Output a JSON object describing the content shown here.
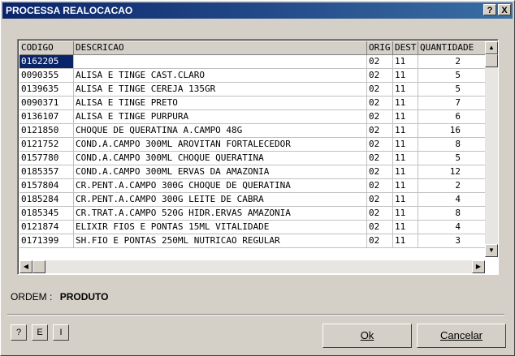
{
  "window": {
    "title": "PROCESSA REALOCACAO",
    "help_btn": "?",
    "close_btn": "X"
  },
  "table": {
    "columns": [
      "CODIGO",
      "DESCRICAO",
      "ORIG",
      "DEST",
      "QUANTIDADE"
    ],
    "rows": [
      {
        "codigo": "0162205",
        "descricao": "",
        "orig": "02",
        "dest": "11",
        "qtd": "2",
        "selected": true
      },
      {
        "codigo": "0090355",
        "descricao": "ALISA E TINGE CAST.CLARO",
        "orig": "02",
        "dest": "11",
        "qtd": "5"
      },
      {
        "codigo": "0139635",
        "descricao": "ALISA E TINGE CEREJA 135GR",
        "orig": "02",
        "dest": "11",
        "qtd": "5"
      },
      {
        "codigo": "0090371",
        "descricao": "ALISA E TINGE PRETO",
        "orig": "02",
        "dest": "11",
        "qtd": "7"
      },
      {
        "codigo": "0136107",
        "descricao": "ALISA E TINGE PURPURA",
        "orig": "02",
        "dest": "11",
        "qtd": "6"
      },
      {
        "codigo": "0121850",
        "descricao": "CHOQUE DE QUERATINA A.CAMPO 48G",
        "orig": "02",
        "dest": "11",
        "qtd": "16"
      },
      {
        "codigo": "0121752",
        "descricao": "COND.A.CAMPO 300ML AROVITAN FORTALECEDOR",
        "orig": "02",
        "dest": "11",
        "qtd": "8"
      },
      {
        "codigo": "0157780",
        "descricao": "COND.A.CAMPO 300ML CHOQUE QUERATINA",
        "orig": "02",
        "dest": "11",
        "qtd": "5"
      },
      {
        "codigo": "0185357",
        "descricao": "COND.A.CAMPO 300ML ERVAS DA AMAZONIA",
        "orig": "02",
        "dest": "11",
        "qtd": "12"
      },
      {
        "codigo": "0157804",
        "descricao": "CR.PENT.A.CAMPO 300G CHOQUE DE QUERATINA",
        "orig": "02",
        "dest": "11",
        "qtd": "2"
      },
      {
        "codigo": "0185284",
        "descricao": "CR.PENT.A.CAMPO 300G LEITE DE CABRA",
        "orig": "02",
        "dest": "11",
        "qtd": "4"
      },
      {
        "codigo": "0185345",
        "descricao": "CR.TRAT.A.CAMPO 520G HIDR.ERVAS AMAZONIA",
        "orig": "02",
        "dest": "11",
        "qtd": "8"
      },
      {
        "codigo": "0121874",
        "descricao": "ELIXIR FIOS E PONTAS 15ML VITALIDADE",
        "orig": "02",
        "dest": "11",
        "qtd": "4"
      },
      {
        "codigo": "0171399",
        "descricao": "SH.FIO E PONTAS 250ML NUTRICAO REGULAR",
        "orig": "02",
        "dest": "11",
        "qtd": "3"
      }
    ]
  },
  "ordem": {
    "label": "ORDEM :",
    "value": "PRODUTO"
  },
  "buttons": {
    "help": "?",
    "e": "E",
    "i": "I",
    "ok": "Ok",
    "cancel": "Cancelar"
  },
  "icons": {
    "scroll_up": "up-arrow-icon",
    "scroll_down": "down-arrow-icon",
    "scroll_left": "left-arrow-icon",
    "scroll_right": "right-arrow-icon"
  }
}
